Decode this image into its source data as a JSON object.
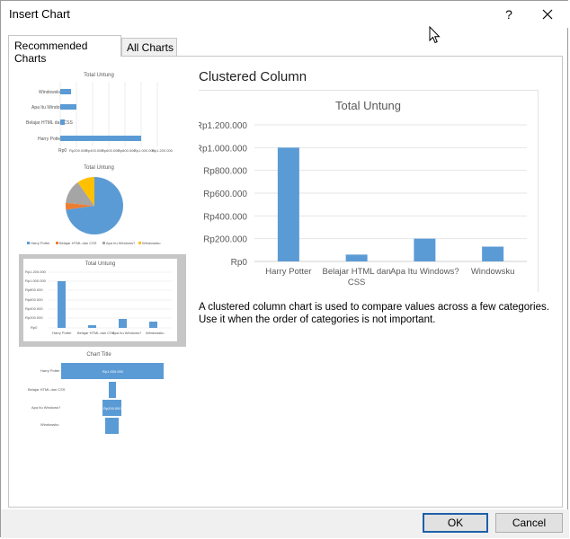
{
  "window": {
    "title": "Insert Chart",
    "help_label": "?"
  },
  "tabs": [
    {
      "label": "Recommended Charts",
      "active": true
    },
    {
      "label": "All Charts",
      "active": false
    }
  ],
  "thumbnails": [
    {
      "kind": "bar",
      "title": "Total Untung",
      "labels": [
        "Windowsku",
        "Apa Itu Windows?",
        "Belajar HTML dan CSS",
        "Harry Potter"
      ],
      "axis": [
        "Rp0",
        "Rp200.000",
        "Rp400.000",
        "Rp600.000",
        "Rp800.000",
        "Rp1.000.000",
        "Rp1.200.000"
      ],
      "values": [
        130000,
        200000,
        60000,
        1000000
      ]
    },
    {
      "kind": "pie",
      "title": "Total Untung",
      "legend": [
        "Harry Potter",
        "Belajar HTML dan CSS",
        "Apa Itu Windows?",
        "Windowsku"
      ],
      "values": [
        1000000,
        60000,
        200000,
        130000
      ],
      "colors": [
        "#5b9bd5",
        "#ed7d31",
        "#a5a5a5",
        "#ffc000"
      ]
    },
    {
      "kind": "column",
      "title": "Total Untung",
      "selected": true,
      "labels": [
        "Harry Potter",
        "Belajar HTML dan CSS",
        "Apa Itu Windows?",
        "Windowsku"
      ],
      "axis": [
        "Rp0",
        "Rp200.000",
        "Rp400.000",
        "Rp600.000",
        "Rp800.000",
        "Rp1.000.000",
        "Rp1.200.000"
      ],
      "values": [
        1000000,
        60000,
        200000,
        130000
      ]
    },
    {
      "kind": "funnel",
      "title": "Chart Title",
      "labels": [
        "Harry Potter",
        "Belajar HTML dan CSS",
        "Apa Itu Windows?",
        "Windowsku"
      ],
      "data_labels": [
        "Rp1.000.000",
        "",
        "Rp200.000",
        ""
      ],
      "values": [
        1000000,
        60000,
        200000,
        130000
      ]
    }
  ],
  "preview": {
    "heading": "Clustered Column",
    "description": "A clustered column chart is used to compare values across a few categories. Use it when the order of categories is not important."
  },
  "chart_data": {
    "type": "bar",
    "title": "Total Untung",
    "categories": [
      "Harry Potter",
      "Belajar HTML dan CSS",
      "Apa Itu Windows?",
      "Windowsku"
    ],
    "values": [
      1000000,
      60000,
      200000,
      130000
    ],
    "ylim": [
      0,
      1200000
    ],
    "yticks": [
      "Rp0",
      "Rp200.000",
      "Rp400.000",
      "Rp600.000",
      "Rp800.000",
      "Rp1.000.000",
      "Rp1.200.000"
    ],
    "grid": true,
    "color": "#5b9bd5"
  },
  "buttons": {
    "ok": "OK",
    "cancel": "Cancel"
  }
}
